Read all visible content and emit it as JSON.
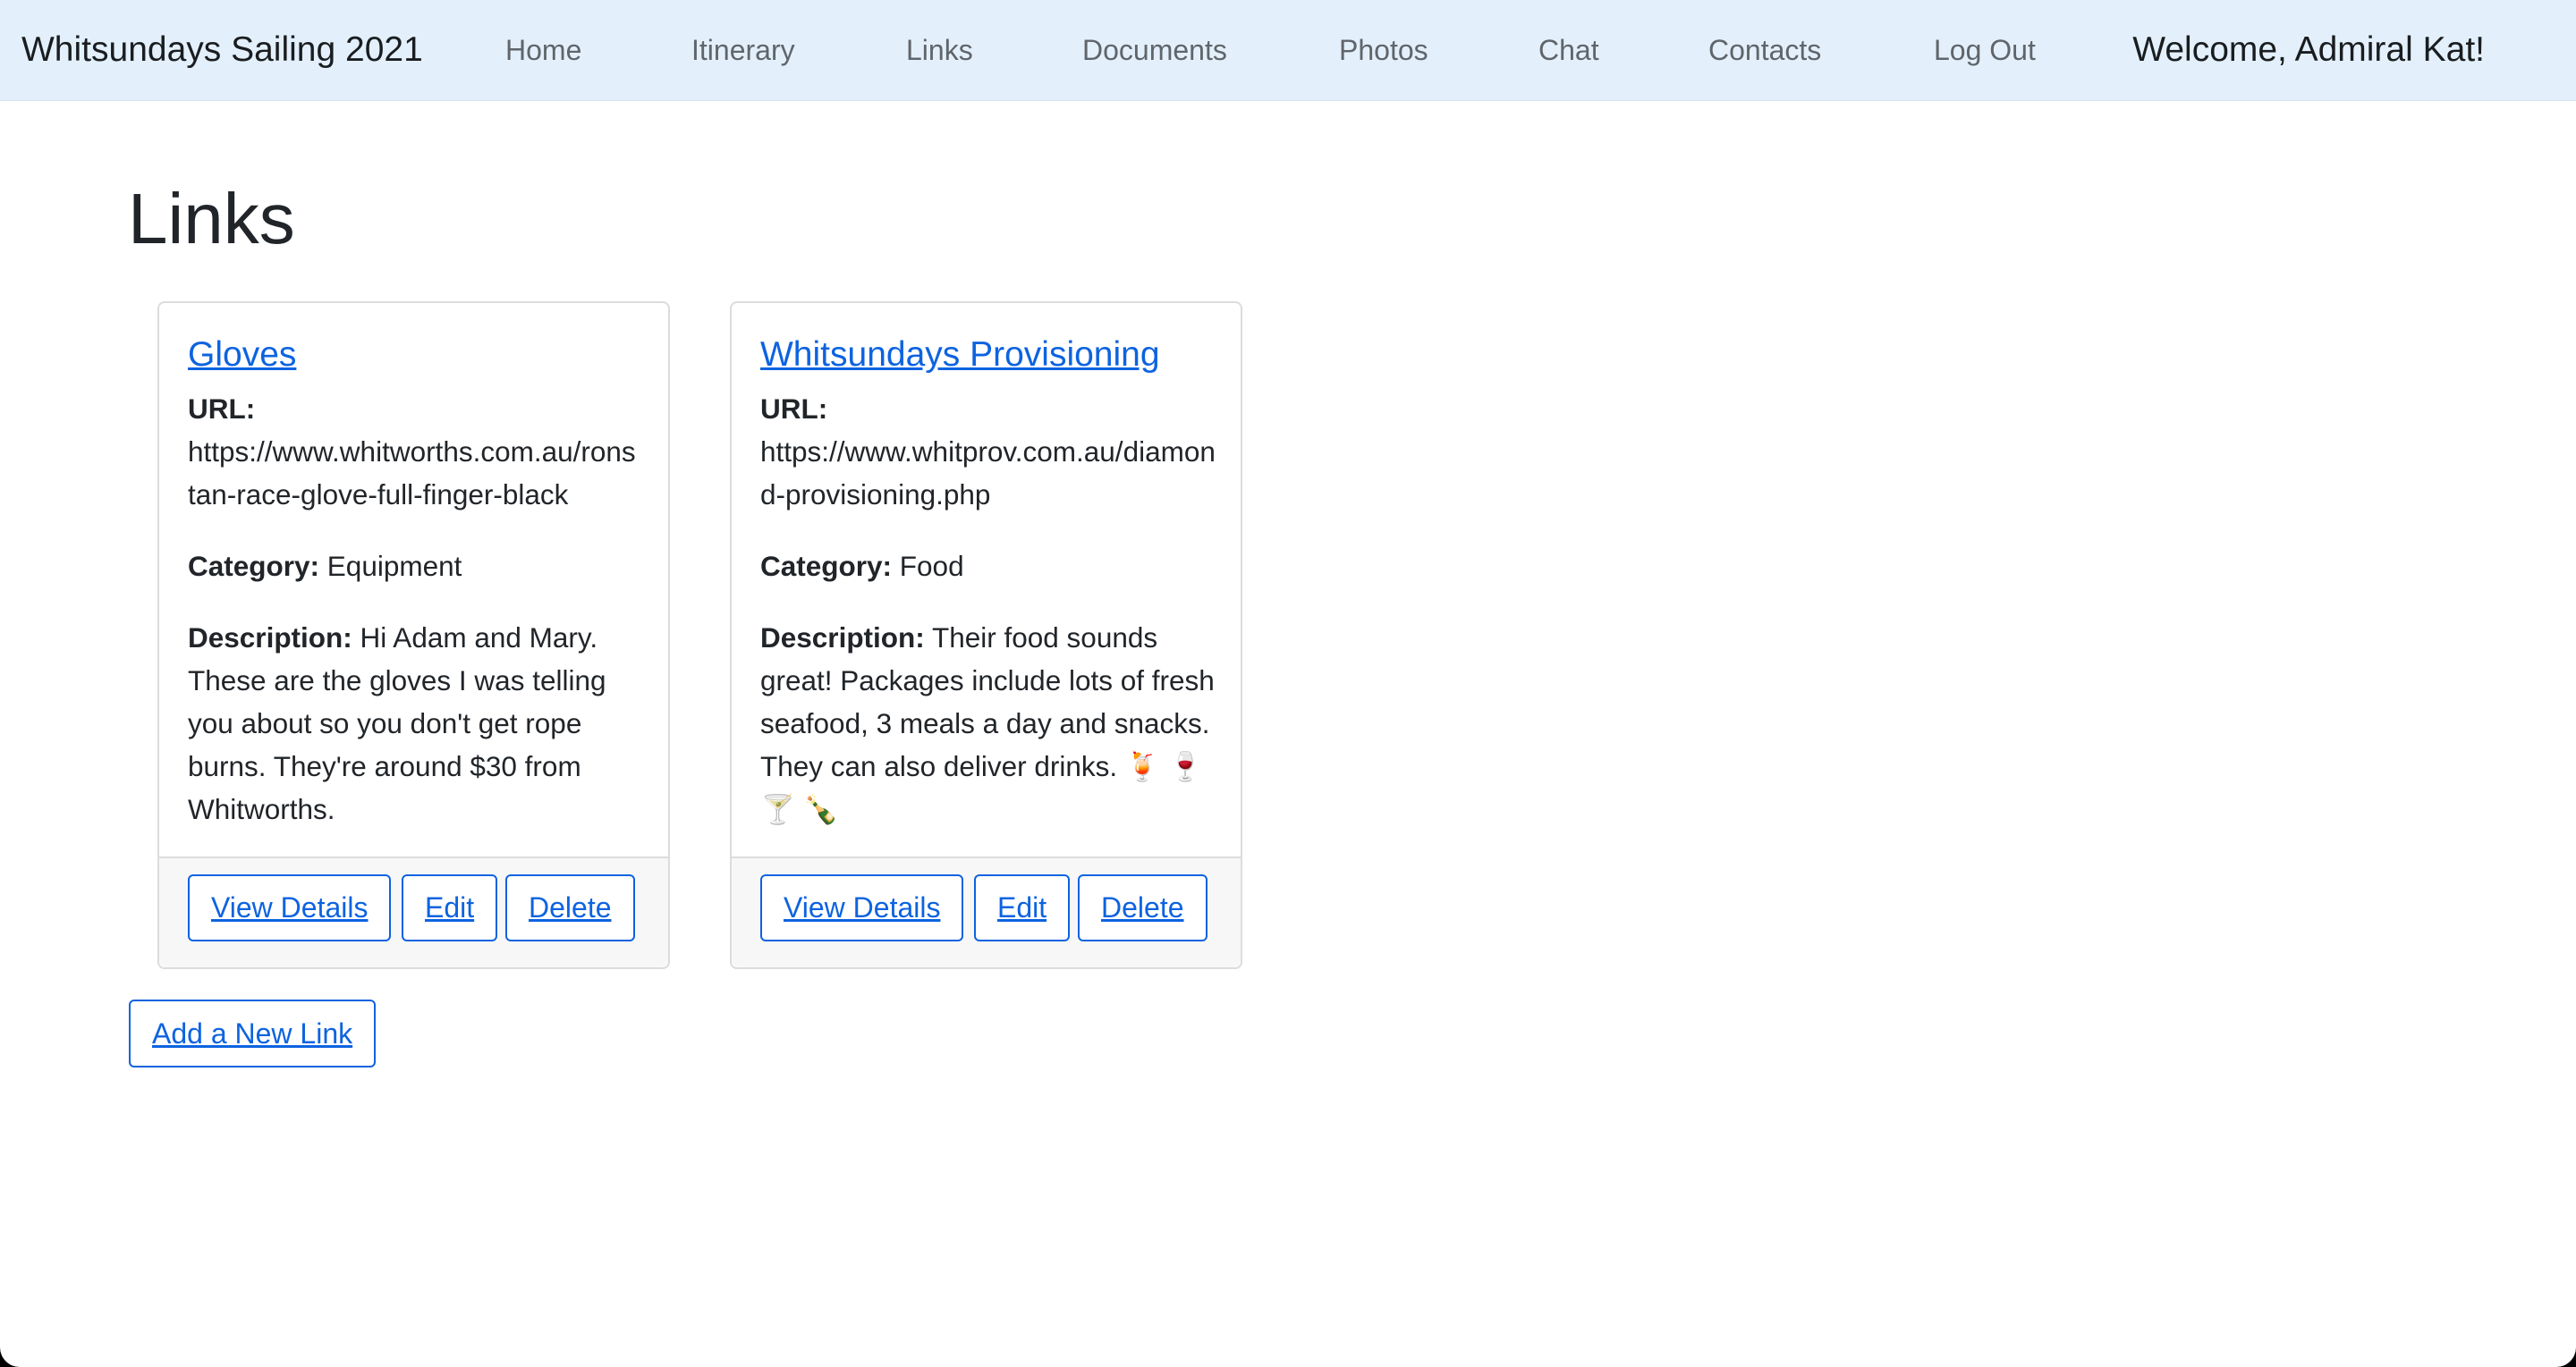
{
  "navbar": {
    "brand": "Whitsundays Sailing 2021",
    "links": [
      "Home",
      "Itinerary",
      "Links",
      "Documents",
      "Photos",
      "Chat",
      "Contacts",
      "Log Out"
    ],
    "welcome": "Welcome, Admiral Kat!"
  },
  "page": {
    "title": "Links"
  },
  "cards": [
    {
      "title": "Gloves",
      "url_label": "URL:",
      "url": "https://www.whitworths.com.au/ronstan-race-glove-full-finger-black",
      "category_label": "Category:",
      "category": "Equipment",
      "description_label": "Description:",
      "description": "Hi Adam and Mary. These are the gloves I was telling you about so you don't get rope burns. They're around $30 from Whitworths.",
      "buttons": {
        "view": "View Details",
        "edit": "Edit",
        "delete": "Delete"
      }
    },
    {
      "title": "Whitsundays Provisioning",
      "url_label": "URL:",
      "url": "https://www.whitprov.com.au/diamond-provisioning.php",
      "category_label": "Category:",
      "category": "Food",
      "description_label": "Description:",
      "description": "Their food sounds great! Packages include lots of fresh seafood, 3 meals a day and snacks. They can also deliver drinks. 🍹 🍷 🍸 🍾",
      "buttons": {
        "view": "View Details",
        "edit": "Edit",
        "delete": "Delete"
      }
    }
  ],
  "add_link_button": "Add a New Link"
}
